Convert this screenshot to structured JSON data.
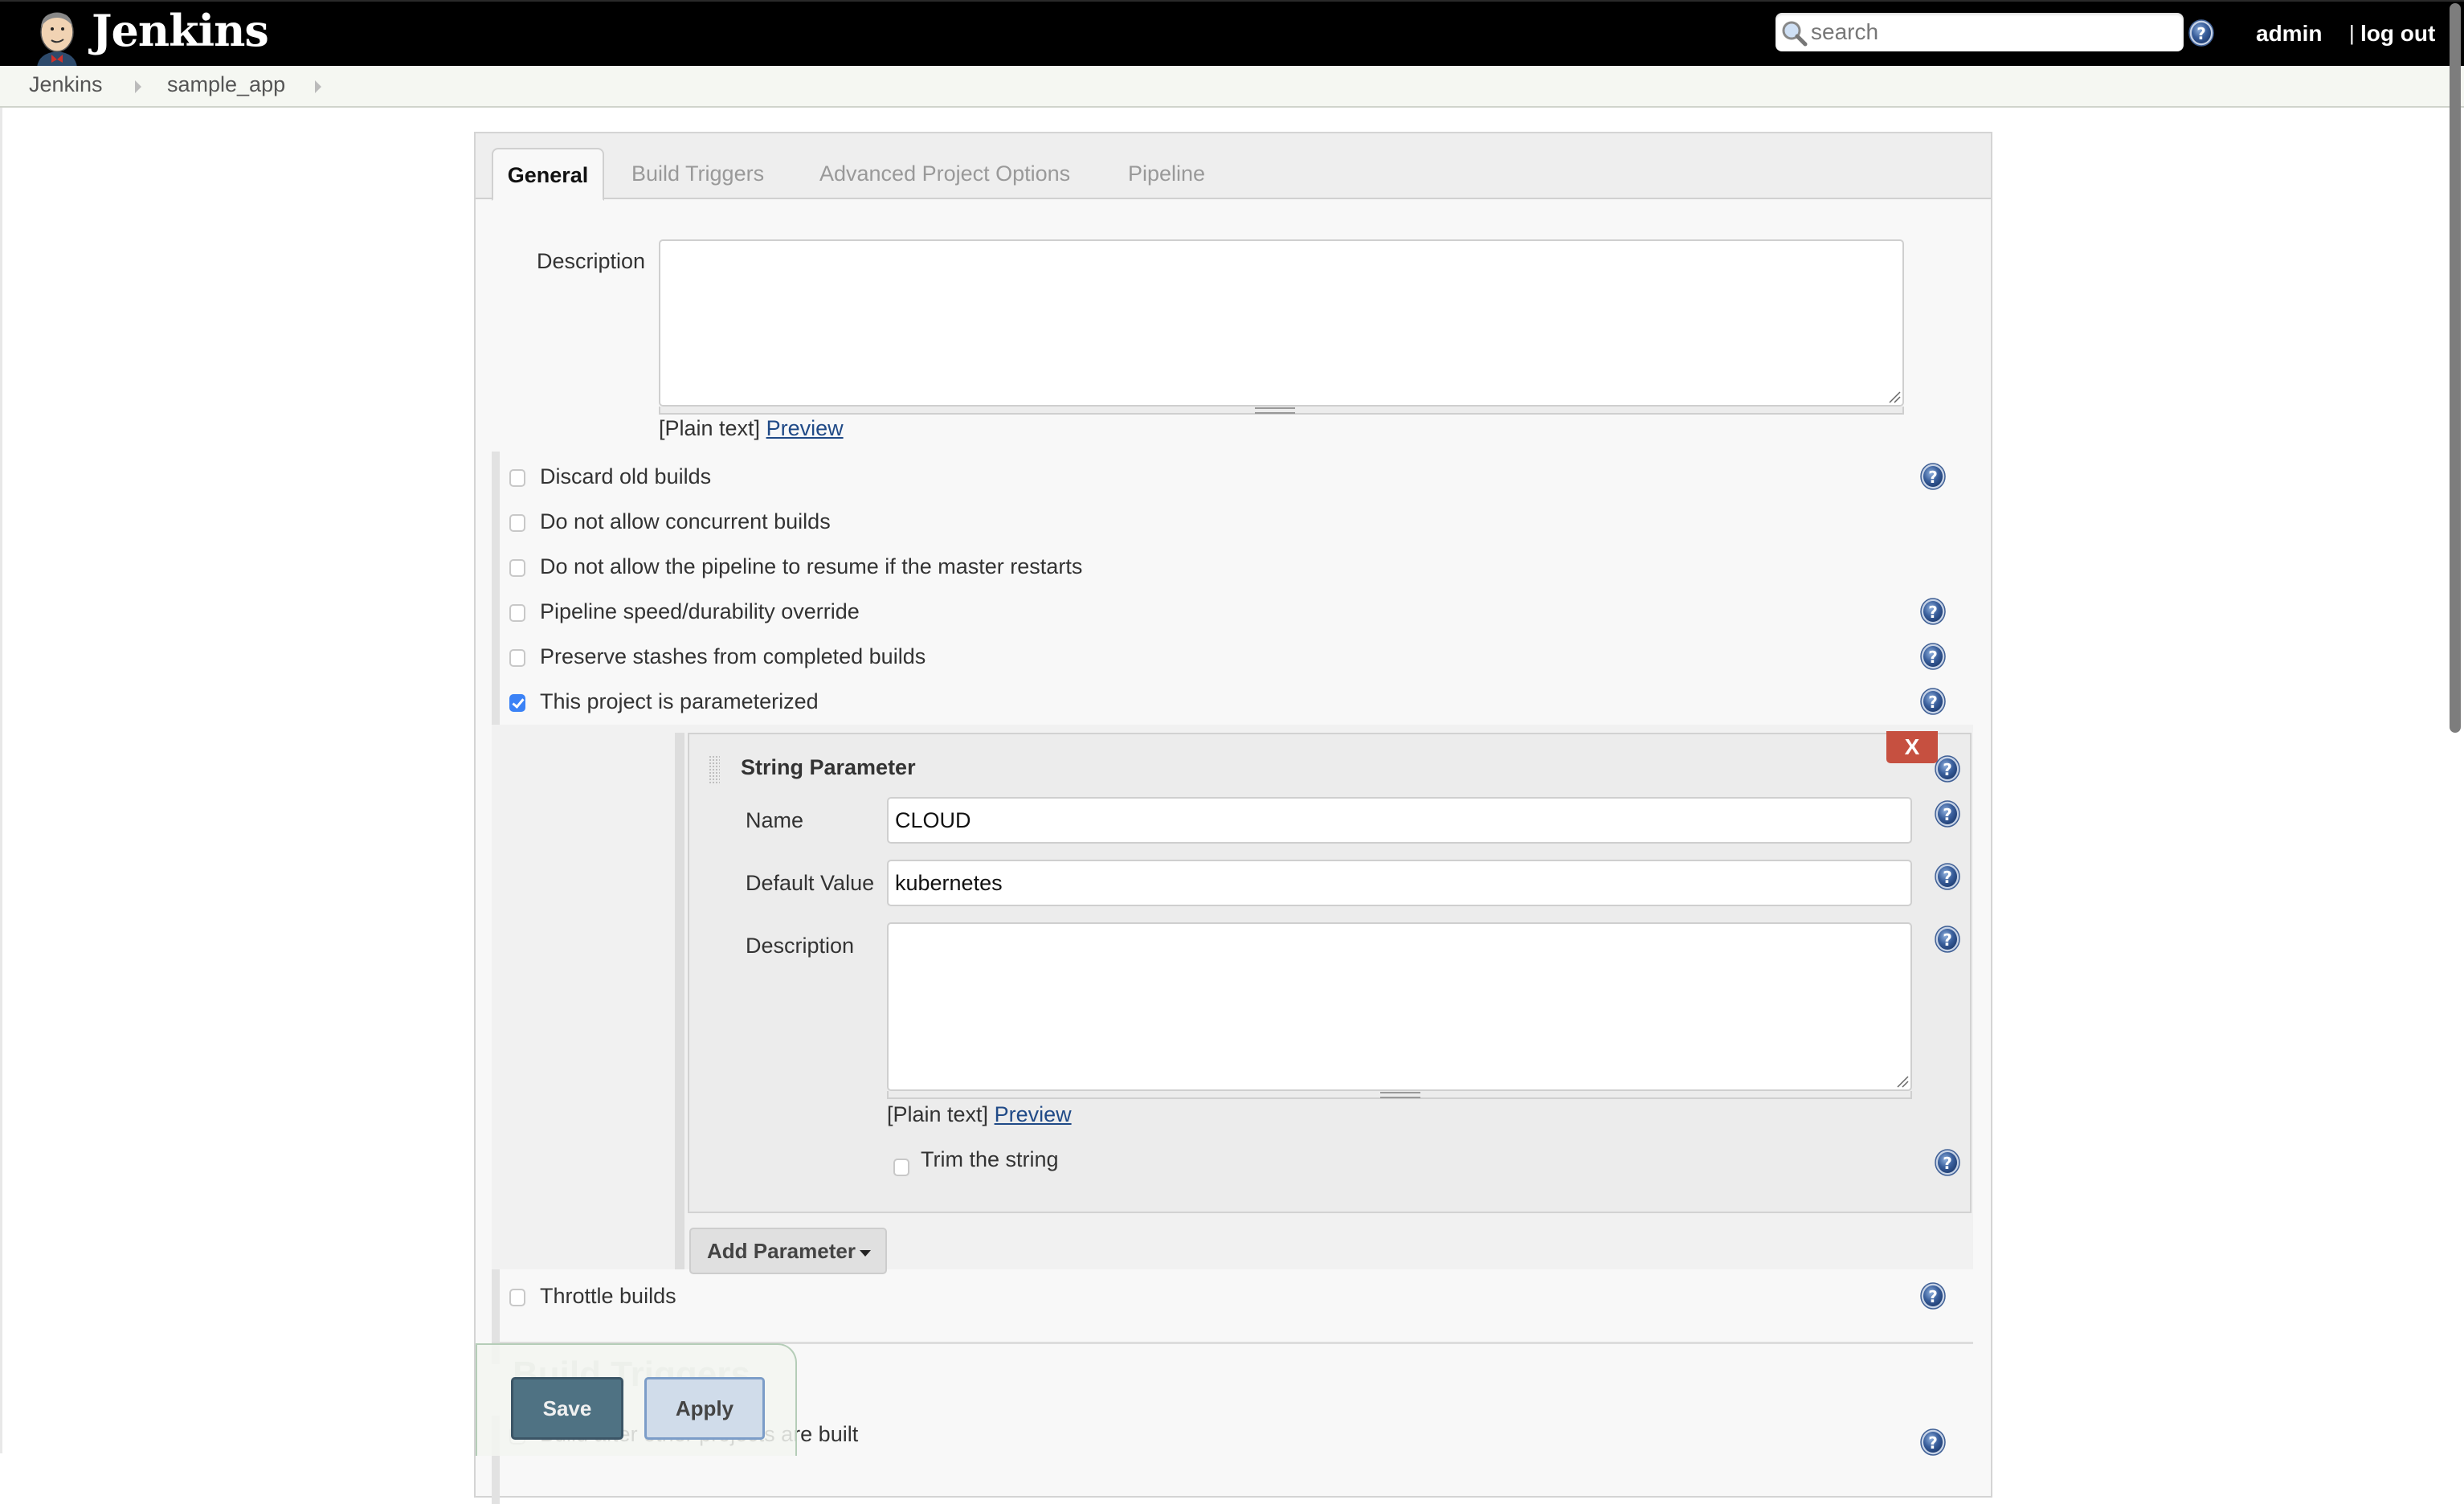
{
  "header": {
    "app_name": "Jenkins",
    "search": {
      "placeholder": "search",
      "value": ""
    },
    "user": "admin",
    "separator": "|",
    "logout": "log out"
  },
  "breadcrumb": [
    {
      "label": "Jenkins"
    },
    {
      "label": "sample_app"
    }
  ],
  "tabs": [
    {
      "label": "General",
      "active": true
    },
    {
      "label": "Build Triggers",
      "active": false
    },
    {
      "label": "Advanced Project Options",
      "active": false
    },
    {
      "label": "Pipeline",
      "active": false
    }
  ],
  "general": {
    "description_label": "Description",
    "description_value": "",
    "format_label": "[Plain text]",
    "preview_link": "Preview",
    "options": [
      {
        "label": "Discard old builds",
        "checked": false,
        "help": true
      },
      {
        "label": "Do not allow concurrent builds",
        "checked": false,
        "help": false
      },
      {
        "label": "Do not allow the pipeline to resume if the master restarts",
        "checked": false,
        "help": false
      },
      {
        "label": "Pipeline speed/durability override",
        "checked": false,
        "help": true
      },
      {
        "label": "Preserve stashes from completed builds",
        "checked": false,
        "help": true
      },
      {
        "label": "This project is parameterized",
        "checked": true,
        "help": true
      }
    ],
    "throttle": {
      "label": "Throttle builds",
      "checked": false
    }
  },
  "string_parameter": {
    "title": "String Parameter",
    "delete_label": "X",
    "name_label": "Name",
    "name_value": "CLOUD",
    "default_label": "Default Value",
    "default_value": "kubernetes",
    "description_label": "Description",
    "description_value": "",
    "format_label": "[Plain text]",
    "preview_link": "Preview",
    "trim_label": "Trim the string",
    "trim_checked": false
  },
  "add_parameter_label": "Add Parameter",
  "build_triggers": {
    "heading": "Build Triggers",
    "first_option": "Build after other projects are built"
  },
  "actions": {
    "save": "Save",
    "apply": "Apply"
  },
  "colors": {
    "header_bg": "#000000",
    "breadcrumb_bg": "#f5f7f2",
    "delete_red": "#c65040",
    "save_bg": "#4f7283",
    "apply_bg": "#d0dcea",
    "link": "#204a87",
    "checkbox_checked": "#3b82f6"
  }
}
